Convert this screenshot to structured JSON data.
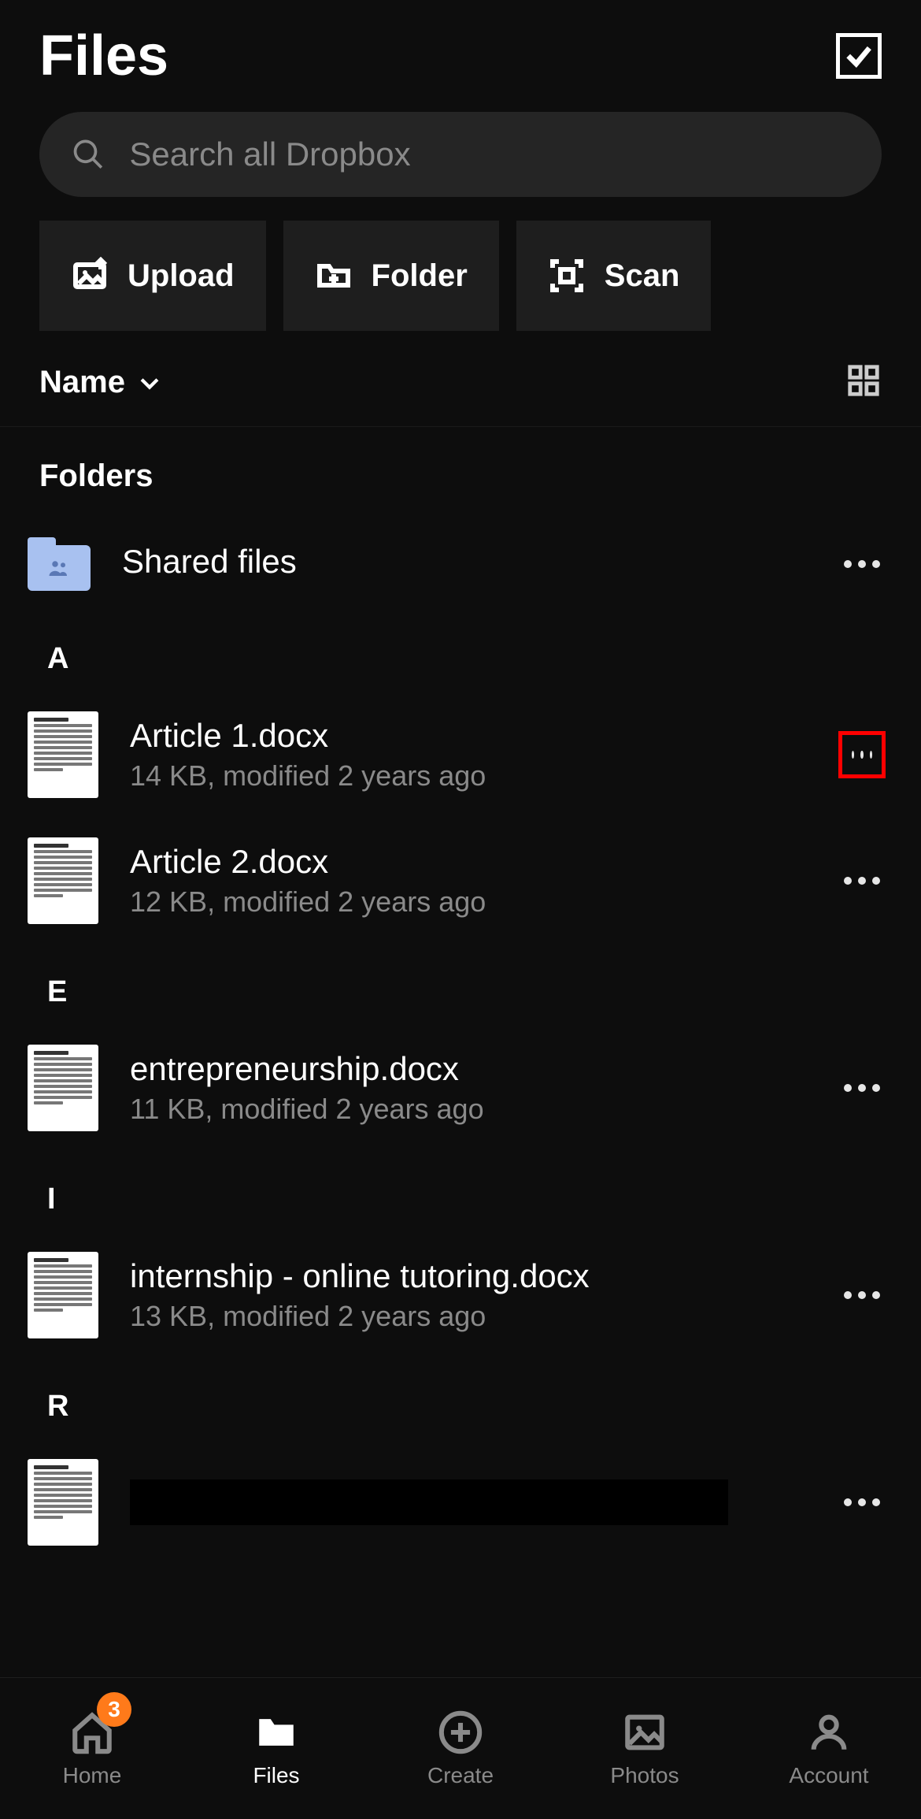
{
  "header": {
    "title": "Files"
  },
  "search": {
    "placeholder": "Search all Dropbox"
  },
  "actions": {
    "upload": "Upload",
    "folder": "Folder",
    "scan": "Scan"
  },
  "sort": {
    "label": "Name"
  },
  "sections": {
    "folders_label": "Folders",
    "folders": [
      {
        "name": "Shared files"
      }
    ],
    "letters": [
      {
        "letter": "A",
        "files": [
          {
            "name": "Article 1.docx",
            "meta": "14 KB, modified 2 years ago",
            "highlight": true
          },
          {
            "name": "Article 2.docx",
            "meta": "12 KB, modified 2 years ago"
          }
        ]
      },
      {
        "letter": "E",
        "files": [
          {
            "name": "entrepreneurship.docx",
            "meta": "11 KB, modified 2 years ago"
          }
        ]
      },
      {
        "letter": "I",
        "files": [
          {
            "name": "internship - online tutoring.docx",
            "meta": "13 KB, modified 2 years ago"
          }
        ]
      },
      {
        "letter": "R",
        "files": [
          {
            "name": "",
            "meta": "",
            "redacted": true
          }
        ]
      }
    ]
  },
  "nav": {
    "home": {
      "label": "Home",
      "badge": "3"
    },
    "files": {
      "label": "Files"
    },
    "create": {
      "label": "Create"
    },
    "photos": {
      "label": "Photos"
    },
    "account": {
      "label": "Account"
    }
  }
}
